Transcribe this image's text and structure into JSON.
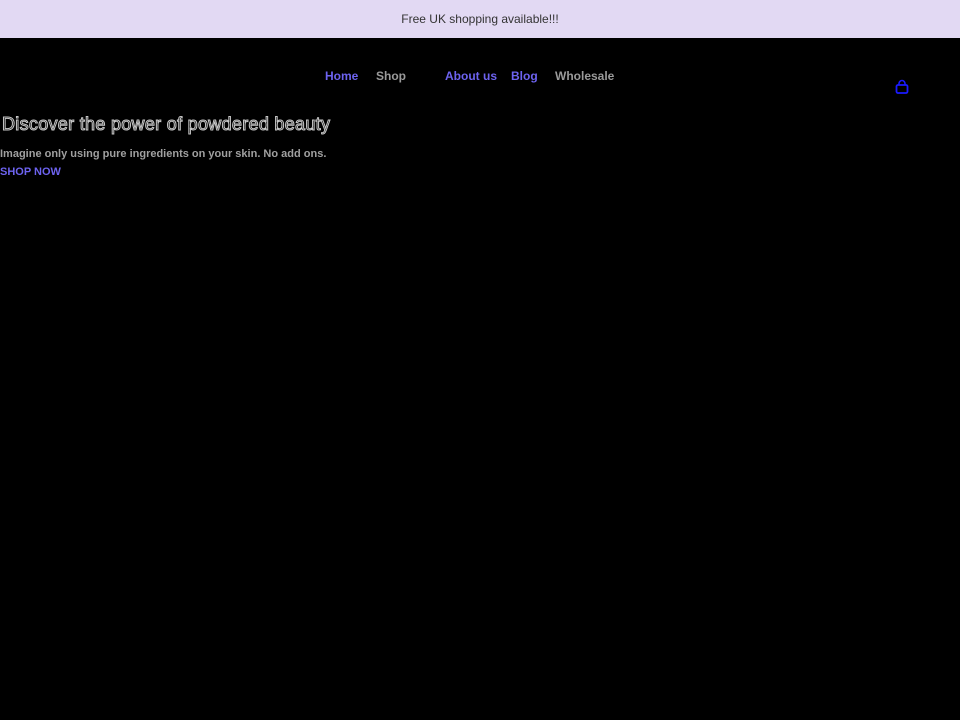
{
  "announcement": {
    "text": "Free UK shopping available!!!"
  },
  "nav": {
    "items": [
      {
        "label": "Home"
      },
      {
        "label": "Shop"
      },
      {
        "label": "About us"
      },
      {
        "label": "Blog"
      },
      {
        "label": "Wholesale"
      }
    ]
  },
  "cart": {
    "icon": "shopping-bag-icon",
    "color": "#1a1aff"
  },
  "hero": {
    "title": "Discover the power of powdered beauty",
    "subtitle": "Imagine only using pure ingredients on your skin. No add ons.",
    "cta_label": "SHOP NOW"
  },
  "colors": {
    "announcement_bg": "#e2d9f3",
    "page_bg": "#000000",
    "accent_link": "#6d63f0",
    "muted_text": "#9a9a9a"
  }
}
